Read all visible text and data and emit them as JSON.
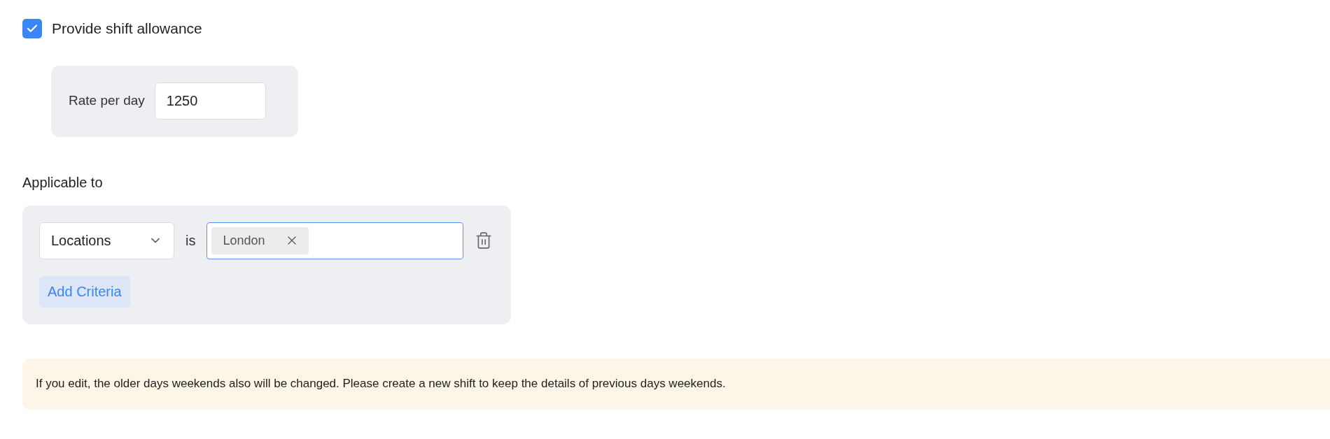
{
  "allowance": {
    "label": "Provide shift allowance",
    "checked": true
  },
  "rate": {
    "label": "Rate per day",
    "value": "1250"
  },
  "applicable": {
    "heading": "Applicable to",
    "criteria": [
      {
        "field": "Locations",
        "operator": "is",
        "tags": [
          "London"
        ]
      }
    ],
    "add_button": "Add Criteria"
  },
  "notice": "If you edit, the older days weekends also will be changed. Please create a new shift to keep the details of previous days weekends."
}
